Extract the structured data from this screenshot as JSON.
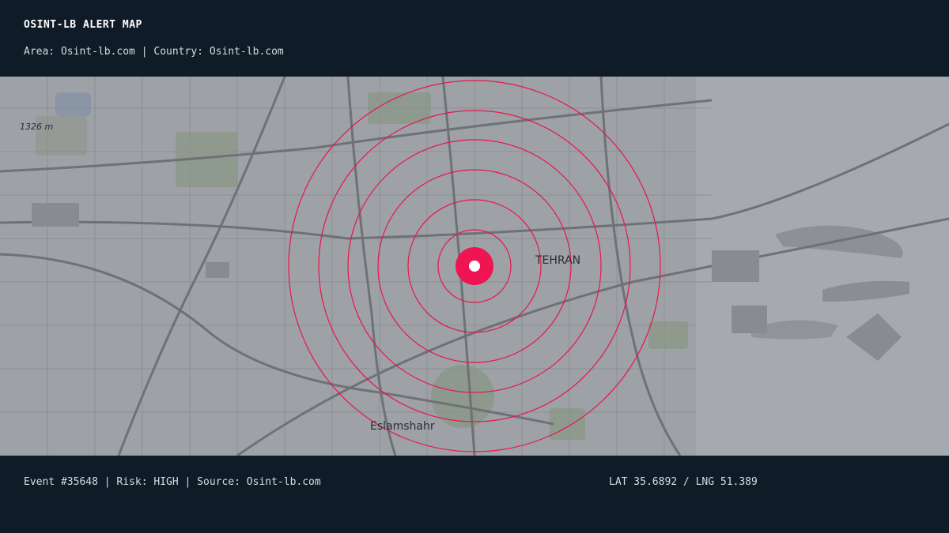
{
  "header": {
    "title": "OSINT-LB ALERT MAP",
    "area_label": "Area:",
    "area_value": "Osint-lb.com",
    "country_label": "Country:",
    "country_value": "Osint-lb.com"
  },
  "map": {
    "labels": {
      "city_main": "TEHRAN",
      "city_secondary": "Eslamshahr",
      "elevation": "1326 m"
    },
    "alert": {
      "ring_count": 6,
      "ring_color": "#e8164f",
      "marker_color": "#ef1552"
    }
  },
  "footer": {
    "event": "Event #35648",
    "risk": "Risk: HIGH",
    "source": "Source: Osint-lb.com",
    "coords": "LAT 35.6892 / LNG 51.389"
  }
}
